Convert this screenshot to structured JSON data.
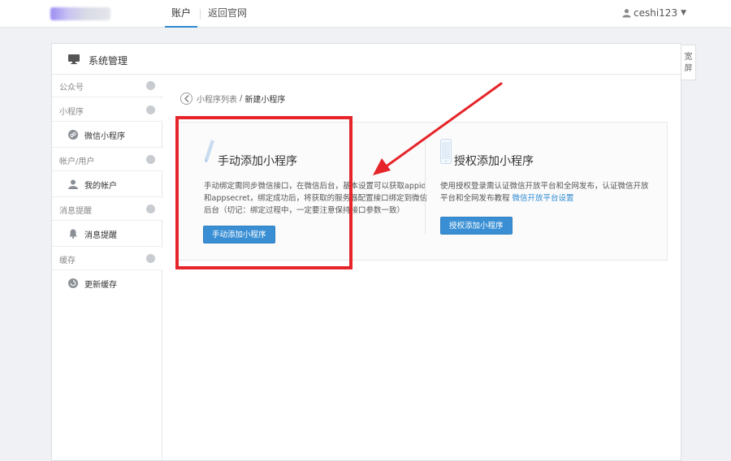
{
  "topbar": {
    "nav": [
      {
        "label": "账户",
        "active": true
      },
      {
        "label": "返回官网",
        "active": false
      }
    ],
    "user": {
      "name": "ceshi123",
      "icon": "user-icon"
    }
  },
  "panel": {
    "title": "系统管理",
    "wide_toggle": "宽屏"
  },
  "sidebar": {
    "groups": [
      {
        "label": "公众号",
        "items": []
      },
      {
        "label": "小程序",
        "items": [
          {
            "label": "微信小程序",
            "icon": "miniprogram-icon"
          }
        ]
      },
      {
        "label": "帐户/用户",
        "items": [
          {
            "label": "我的帐户",
            "icon": "user-icon"
          }
        ]
      },
      {
        "label": "消息提醒",
        "items": [
          {
            "label": "消息提醒",
            "icon": "bell-icon"
          }
        ]
      },
      {
        "label": "缓存",
        "items": [
          {
            "label": "更新缓存",
            "icon": "refresh-icon"
          }
        ]
      }
    ]
  },
  "breadcrumb": {
    "parent": "小程序列表",
    "separator": "/",
    "current": "新建小程序"
  },
  "cards": [
    {
      "title": "手动添加小程序",
      "icon": "pen-icon",
      "desc_lines": [
        "手动绑定需同步微信接口，在微信后台，基本设置可以获取appid",
        "和appsecret，绑定成功后，将获取的服务器配置接口绑定到微信",
        "后台（切记：绑定过程中，一定要注意保持接口参数一致）"
      ],
      "button": "手动添加小程序"
    },
    {
      "title": "授权添加小程序",
      "icon": "phone-icon",
      "desc_lines": [
        "使用授权登录需认证微信开放平台和全网发布，认证微信开放",
        "平台和全网发布教程 "
      ],
      "desc_link": "微信开放平台设置",
      "button": "授权添加小程序"
    }
  ],
  "colors": {
    "accent": "#3a8fd4",
    "annotation": "#e5252a",
    "background": "#eff1f4"
  }
}
